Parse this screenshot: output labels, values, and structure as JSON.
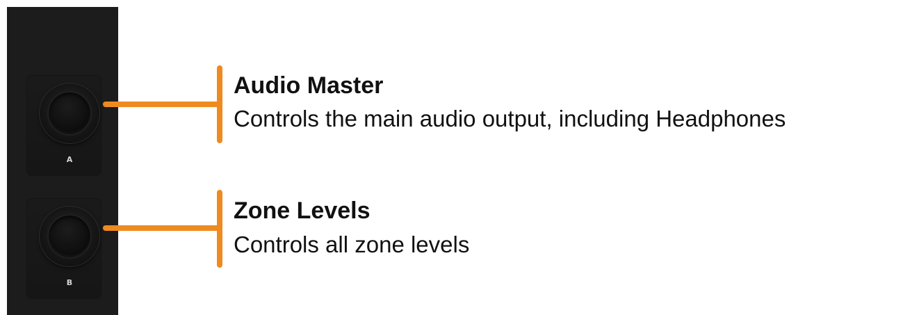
{
  "device": {
    "knobs": [
      {
        "label": "A"
      },
      {
        "label": "B"
      }
    ]
  },
  "callouts": [
    {
      "title": "Audio Master",
      "description": "Controls the main audio output, including Headphones"
    },
    {
      "title": "Zone Levels",
      "description": "Controls all zone levels"
    }
  ],
  "colors": {
    "accent": "#ee8a1f",
    "panel": "#1c1c1c",
    "text": "#111111",
    "knob_label": "#d6d6d6"
  }
}
